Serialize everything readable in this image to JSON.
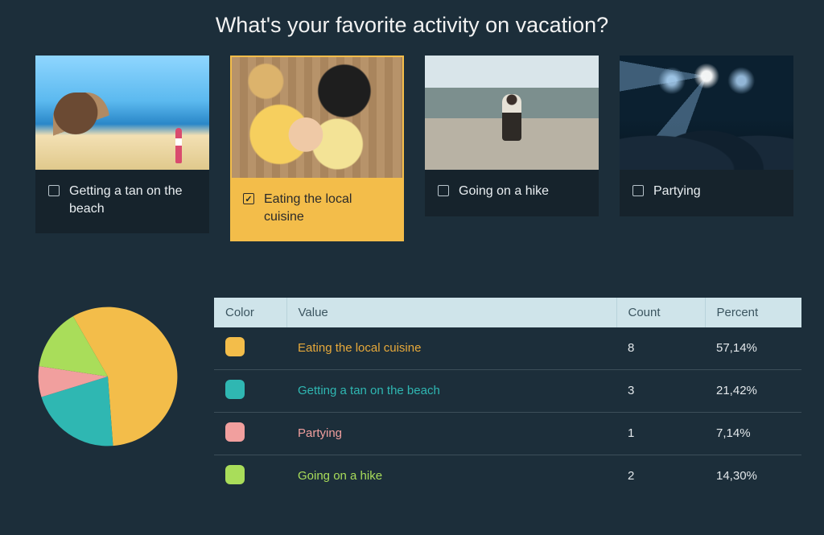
{
  "question": "What's your favorite activity on vacation?",
  "options": [
    {
      "label": "Getting a tan on the beach",
      "selected": false,
      "thumb": "thumb-beach"
    },
    {
      "label": "Eating the local cuisine",
      "selected": true,
      "thumb": "thumb-food"
    },
    {
      "label": "Going on a hike",
      "selected": false,
      "thumb": "thumb-hike"
    },
    {
      "label": "Partying",
      "selected": false,
      "thumb": "thumb-party"
    }
  ],
  "results": {
    "headers": {
      "color": "Color",
      "value": "Value",
      "count": "Count",
      "percent": "Percent"
    },
    "rows": [
      {
        "color": "#f3bd4a",
        "value": "Eating the local cuisine",
        "count": "8",
        "percent": "57,14%",
        "text_color": "#e7a93a"
      },
      {
        "color": "#2fb7b2",
        "value": "Getting a tan on the beach",
        "count": "3",
        "percent": "21,42%",
        "text_color": "#2fb7b2"
      },
      {
        "color": "#f19f9e",
        "value": "Partying",
        "count": "1",
        "percent": "7,14%",
        "text_color": "#f19f9e"
      },
      {
        "color": "#a9dd5a",
        "value": "Going on a hike",
        "count": "2",
        "percent": "14,30%",
        "text_color": "#a9dd5a"
      }
    ]
  },
  "chart_data": {
    "type": "pie",
    "title": "What's your favorite activity on vacation?",
    "categories": [
      "Eating the local cuisine",
      "Getting a tan on the beach",
      "Partying",
      "Going on a hike"
    ],
    "values": [
      8,
      3,
      1,
      2
    ],
    "percent": [
      57.14,
      21.42,
      7.14,
      14.3
    ],
    "colors": [
      "#f3bd4a",
      "#2fb7b2",
      "#f19f9e",
      "#a9dd5a"
    ]
  }
}
